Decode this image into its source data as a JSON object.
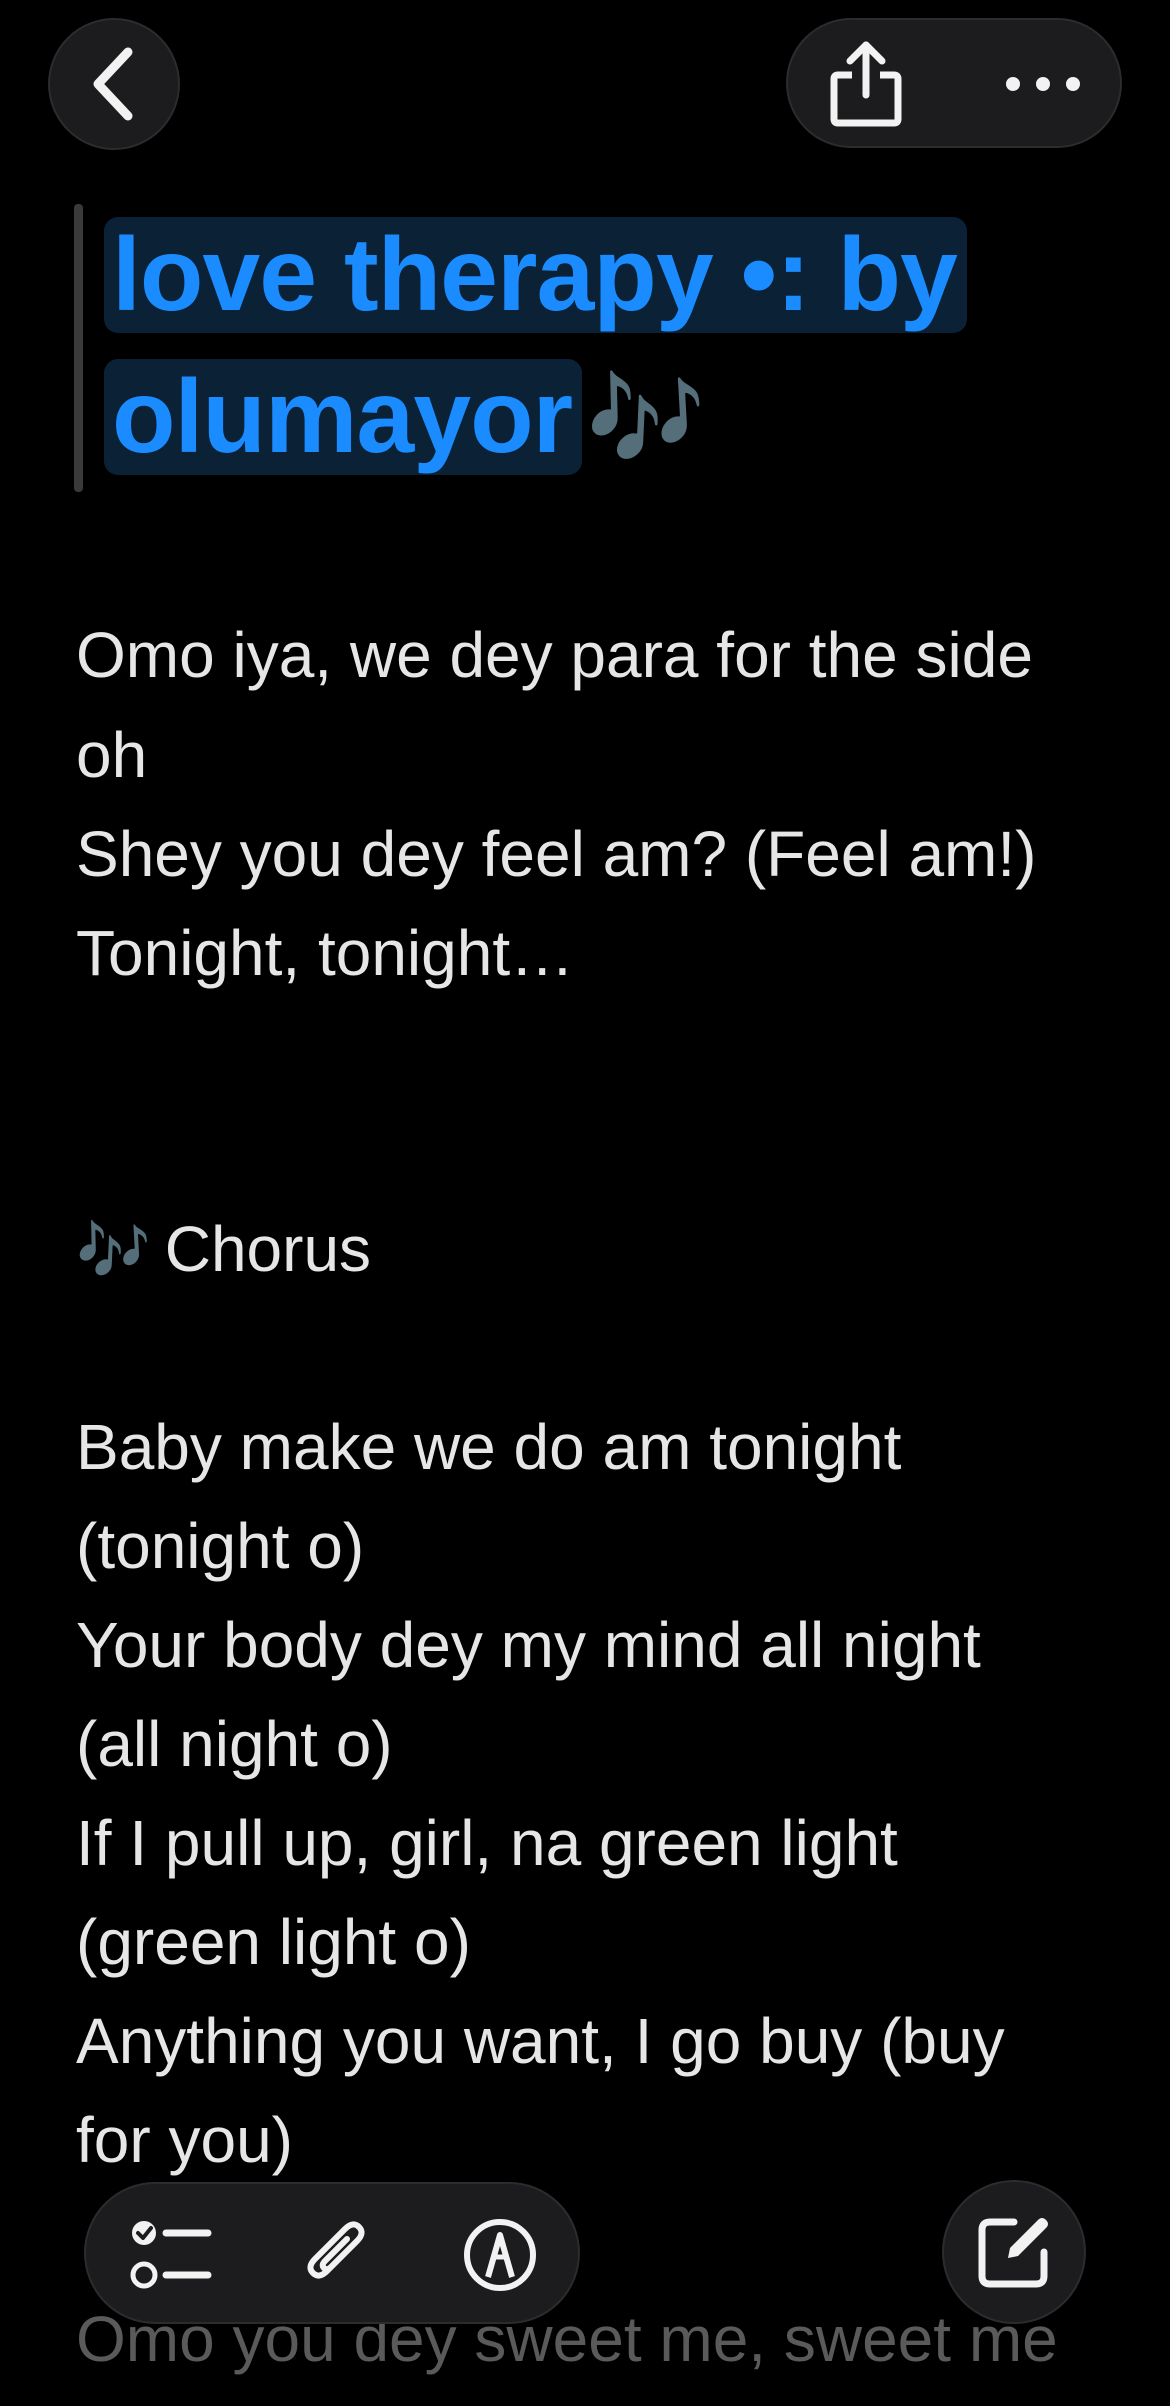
{
  "header": {
    "back_icon": "chevron-left-icon",
    "share_icon": "share-icon",
    "more_icon": "ellipsis-icon"
  },
  "note": {
    "title_part1": "love therapy •: by",
    "title_part2": "olumayor",
    "title_emoji": "🎶",
    "lines": [
      "Omo iya, we dey para for the side",
      "oh",
      "Shey you dey feel am? (Feel am!)",
      "Tonight, tonight…",
      "Chorus",
      "Baby make we do am tonight",
      "(tonight o)",
      "Your body dey my mind all night",
      "(all night o)",
      "If I pull up, girl, na green light",
      "(green light o)",
      "Anything you want, I go buy (buy",
      "for you)",
      "Omo you dey sweet me, sweet me"
    ],
    "chorus_emoji": "🎶"
  },
  "toolbar": {
    "checklist_icon": "checklist-icon",
    "attach_icon": "paperclip-icon",
    "markup_icon": "markup-pen-icon",
    "compose_icon": "compose-icon"
  },
  "colors": {
    "background": "#000000",
    "title_blue": "#1a8cff",
    "title_highlight": "#0b2236",
    "text": "#e6e6e6",
    "button_bg": "#1c1c1e"
  }
}
